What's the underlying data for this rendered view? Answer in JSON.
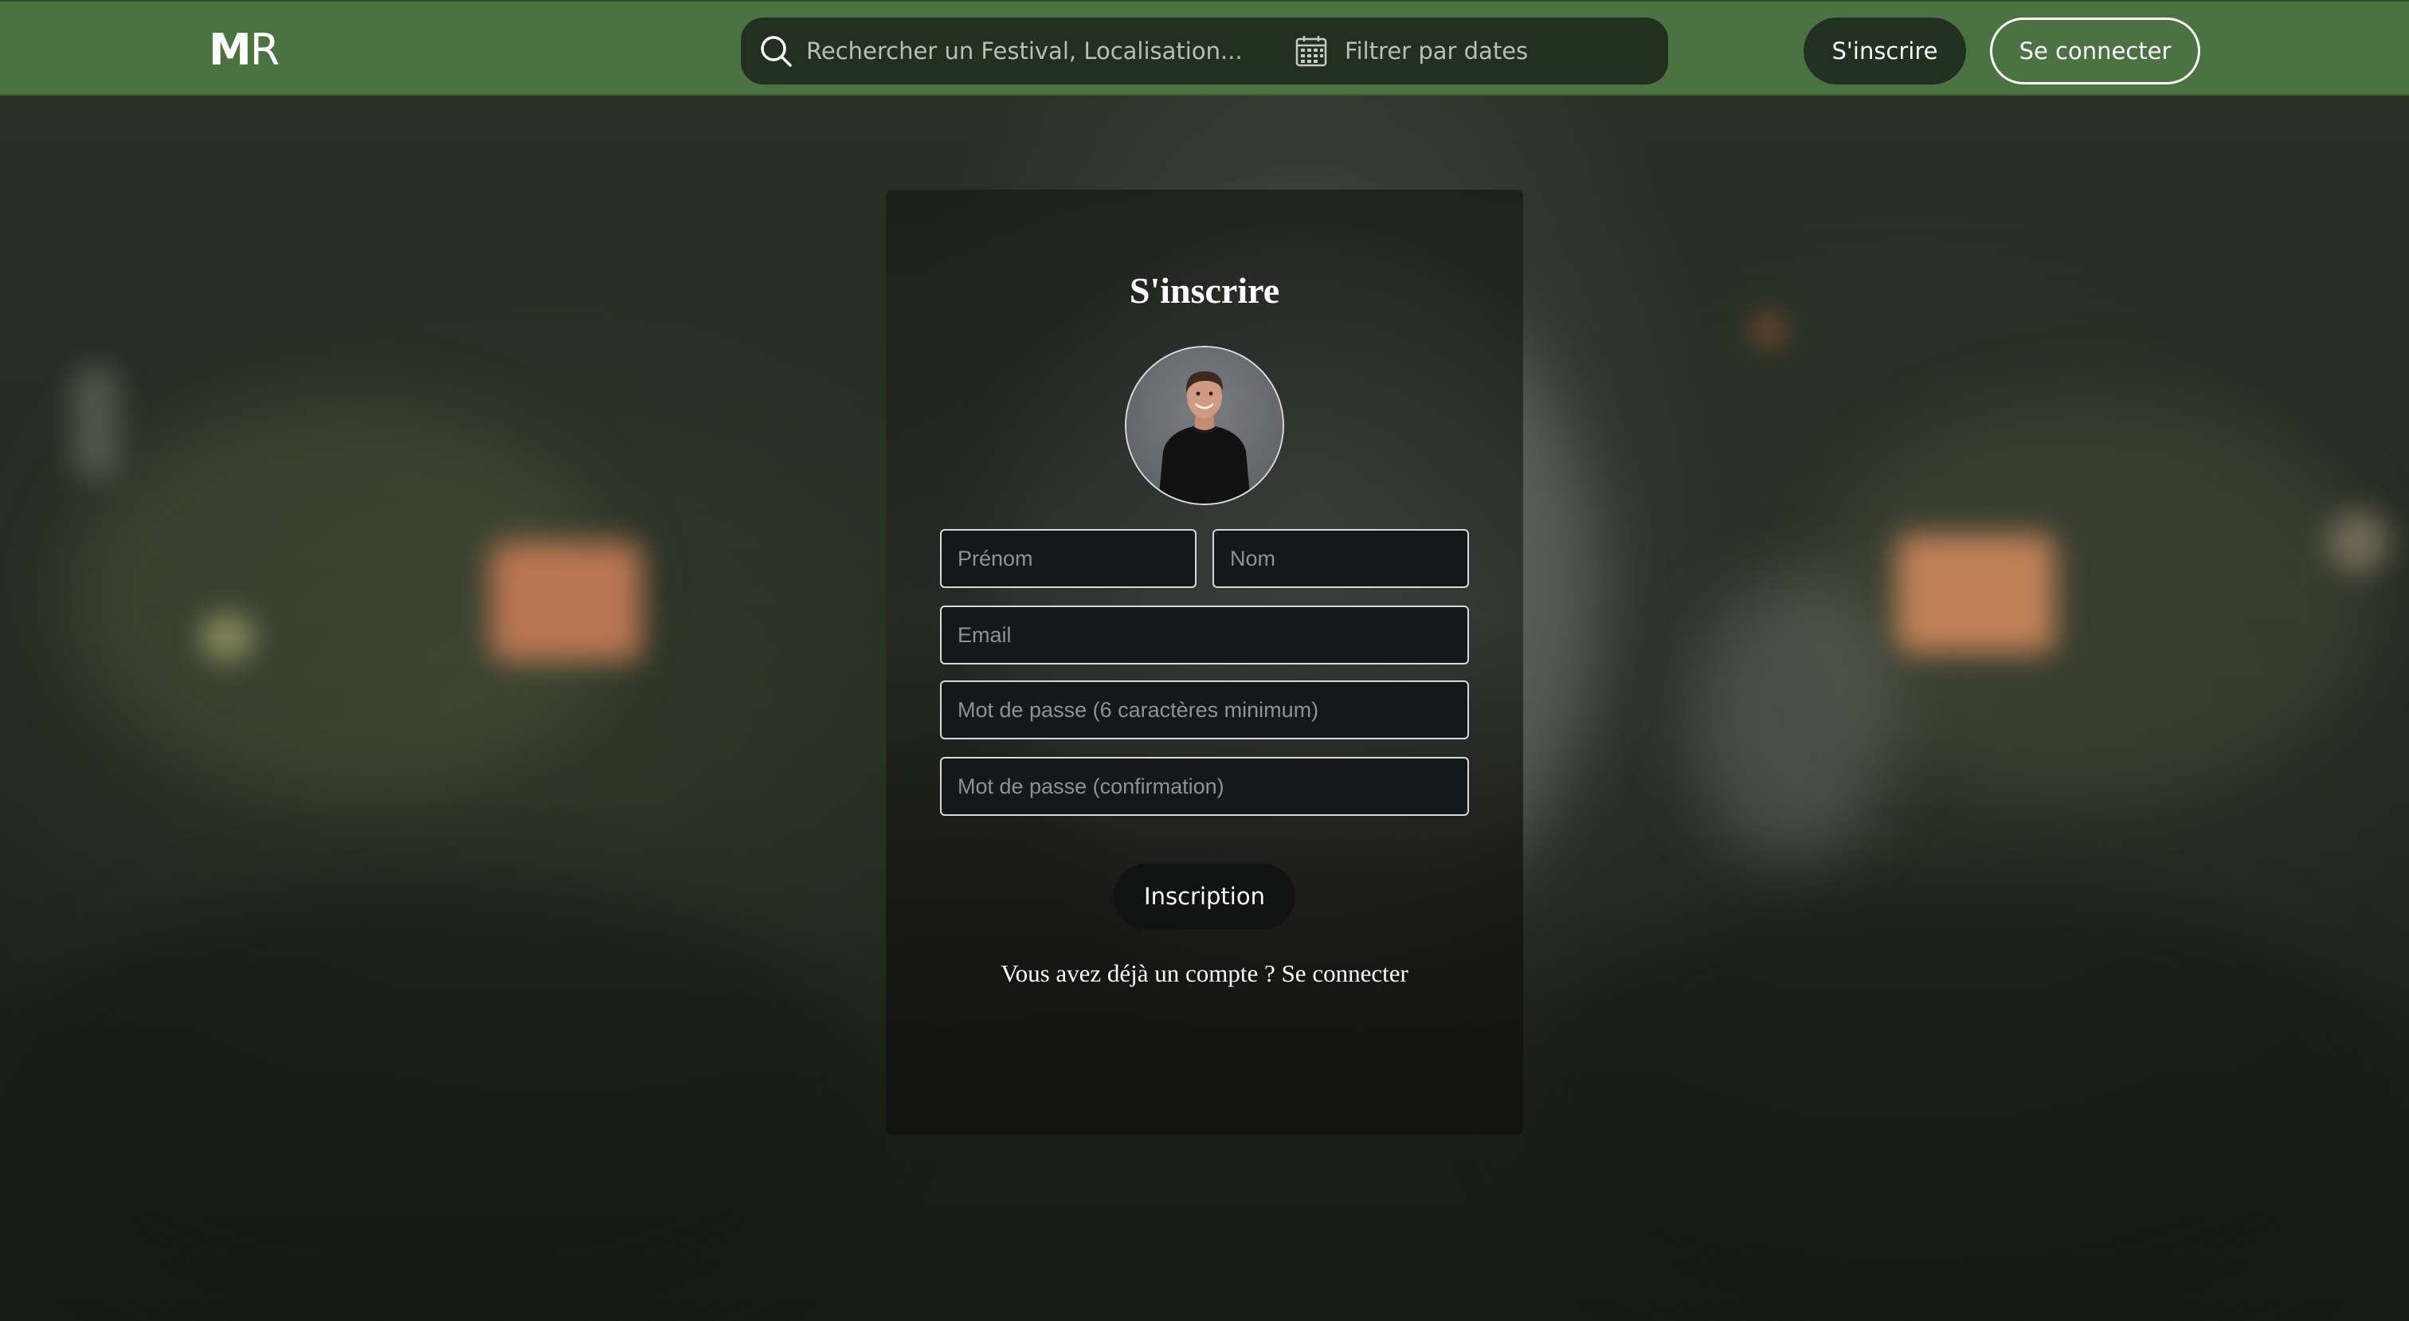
{
  "header": {
    "logo_primary": "M",
    "logo_secondary": "R",
    "search": {
      "placeholder": "Rechercher un Festival, Localisation...",
      "icon": "search-icon"
    },
    "date_filter": {
      "placeholder": "Filtrer par dates",
      "icon": "calendar-icon"
    },
    "signup_label": "S'inscrire",
    "login_label": "Se connecter"
  },
  "form": {
    "title": "S'inscrire",
    "avatar_alt": "Photo de profil",
    "fields": {
      "firstname_placeholder": "Prénom",
      "lastname_placeholder": "Nom",
      "email_placeholder": "Email",
      "password_placeholder": "Mot de passe (6 caractères minimum)",
      "confirm_placeholder": "Mot de passe (confirmation)"
    },
    "submit_label": "Inscription",
    "login_prompt": "Vous avez déjà un compte ? ",
    "login_link": "Se connecter"
  },
  "colors": {
    "header_bg": "#4b7342",
    "search_bg": "#22301f",
    "primary_button_bg": "#213021",
    "card_bg": "#1c1e1c",
    "field_bg": "#15171b"
  }
}
